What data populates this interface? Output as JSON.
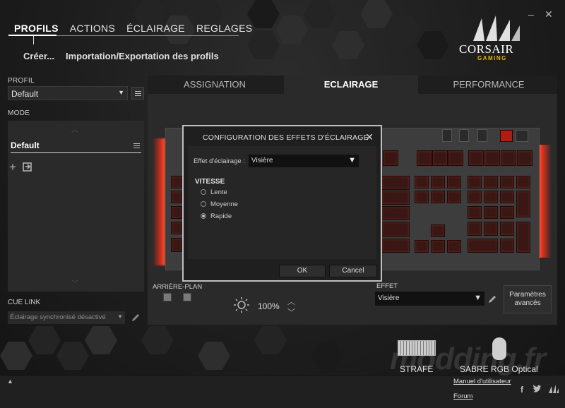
{
  "window": {
    "minimize": "_",
    "close": "✕"
  },
  "topnav": {
    "tabs": [
      {
        "label": "PROFILS"
      },
      {
        "label": "ACTIONS"
      },
      {
        "label": "ÉCLAIRAGE"
      },
      {
        "label": "REGLAGES"
      }
    ]
  },
  "subnav": {
    "create": "Créer...",
    "import_export": "Importation/Exportation des profils"
  },
  "logo": {
    "brand": "CORSAIR",
    "sub": "GAMING"
  },
  "sidebar": {
    "profil_label": "PROFIL",
    "profil_value": "Default",
    "mode_label": "MODE",
    "mode_item": "Default",
    "cue_link_label": "CUE LINK",
    "cue_link_value": "Éclairage synchronisé désactivé"
  },
  "main": {
    "tabs": [
      {
        "label": "ASSIGNATION"
      },
      {
        "label": "ECLAIRAGE"
      },
      {
        "label": "PERFORMANCE"
      }
    ]
  },
  "modal": {
    "title": "CONFIGURATION DES EFFETS D'ÉCLAIRAGE",
    "effect_label": "Effet d'éclairage :",
    "effect_value": "Visière",
    "speed_label": "VITESSE",
    "speed_options": [
      {
        "label": "Lente",
        "selected": false
      },
      {
        "label": "Moyenne",
        "selected": false
      },
      {
        "label": "Rapide",
        "selected": true
      }
    ],
    "ok": "OK",
    "cancel": "Cancel"
  },
  "controls": {
    "background_label": "ARRIÈRE-PLAN",
    "brightness": "100%",
    "effect_label": "EFFET",
    "effect_value": "Visière",
    "params_line1": "Paramètres",
    "params_line2": "avancés"
  },
  "footer": {
    "device1": "STRAFE",
    "device2": "SABRE RGB Optical",
    "manual": "Manuel d'utilisateur",
    "forum": "Forum",
    "watermark": "modding.fr"
  },
  "colors": {
    "accent_logo": "#e7b300",
    "glow": "#d8301c",
    "key_red": "#3a1714"
  }
}
